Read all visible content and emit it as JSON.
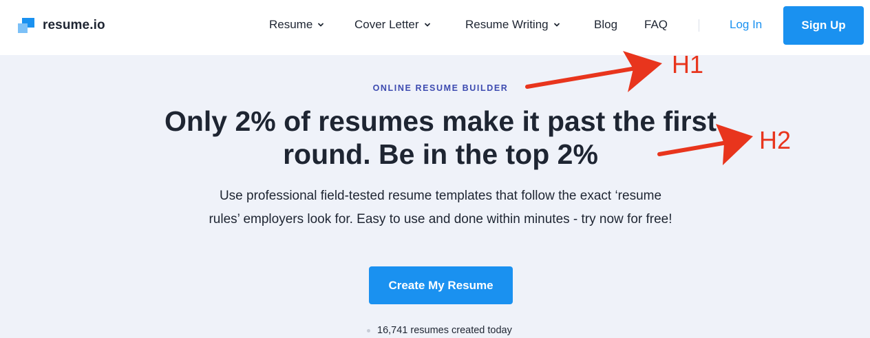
{
  "header": {
    "logo_text": "resume.io",
    "nav": [
      {
        "label": "Resume",
        "has_dropdown": true
      },
      {
        "label": "Cover Letter",
        "has_dropdown": true
      },
      {
        "label": "Resume Writing",
        "has_dropdown": true
      },
      {
        "label": "Blog",
        "has_dropdown": false
      },
      {
        "label": "FAQ",
        "has_dropdown": false
      }
    ],
    "login_label": "Log In",
    "signup_label": "Sign Up"
  },
  "hero": {
    "eyebrow": "ONLINE RESUME BUILDER",
    "headline": "Only 2% of resumes make it past the first round. Be in the top 2%",
    "subtext": "Use professional field-tested resume templates that follow the exact ‘resume rules’ employers look for. Easy to use and done within minutes - try now for free!",
    "cta_label": "Create My Resume",
    "counter_text": "16,741 resumes created today"
  },
  "annotations": {
    "h1_label": "H1",
    "h2_label": "H2",
    "color": "#e8351d"
  },
  "colors": {
    "brand_blue": "#1a91f0",
    "hero_bg": "#eff2f9",
    "eyebrow": "#3d4bb0",
    "text": "#1e2532"
  }
}
